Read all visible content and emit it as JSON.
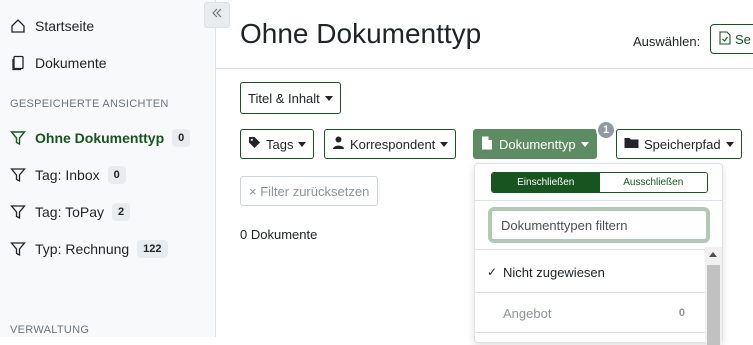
{
  "sidebar": {
    "collapse_icon": "double-chevron-left-icon",
    "nav": [
      {
        "label": "Startseite",
        "icon": "home-icon"
      },
      {
        "label": "Dokumente",
        "icon": "documents-icon"
      }
    ],
    "saved_views_heading": "GESPEICHERTE ANSICHTEN",
    "saved_views": [
      {
        "label": "Ohne Dokumenttyp",
        "count": "0",
        "active": true
      },
      {
        "label": "Tag: Inbox",
        "count": "0"
      },
      {
        "label": "Tag: ToPay",
        "count": "2"
      },
      {
        "label": "Typ: Rechnung",
        "count": "122"
      }
    ],
    "management_heading": "VERWALTUNG"
  },
  "header": {
    "title": "Ohne Dokumenttyp",
    "select_label": "Auswählen:",
    "select_button": "Se"
  },
  "filters": {
    "text_filter_button": "Titel & Inhalt",
    "tags_button": "Tags",
    "correspondent_button": "Korrespondent",
    "doctype_button": "Dokumenttyp",
    "doctype_active_count": "1",
    "storage_path_button": "Speicherpfad",
    "reset_button": "× Filter zurücksetzen"
  },
  "document_count": "0 Dokumente",
  "dropdown": {
    "include_label": "Einschließen",
    "exclude_label": "Ausschließen",
    "filter_placeholder": "Dokumenttypen filtern",
    "items": [
      {
        "label": "Nicht zugewiesen",
        "checked": true,
        "count": ""
      },
      {
        "label": "Angebot",
        "checked": false,
        "count": "0"
      }
    ]
  },
  "colors": {
    "primary": "#17541f",
    "active_button": "#5e8c62",
    "badge_count": "#8f9aa3"
  }
}
